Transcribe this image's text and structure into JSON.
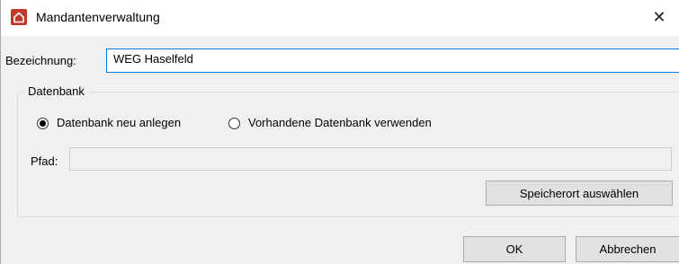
{
  "window": {
    "title": "Mandantenverwaltung",
    "icon": "home-icon",
    "close_glyph": "✕"
  },
  "bezeichnung": {
    "label": "Bezeichnung:",
    "value": "WEG Haselfeld"
  },
  "datenbank": {
    "group_label": "Datenbank",
    "options": [
      {
        "label": "Datenbank neu anlegen",
        "selected": true
      },
      {
        "label": "Vorhandene Datenbank verwenden",
        "selected": false
      }
    ],
    "pfad_label": "Pfad:",
    "pfad_value": "",
    "browse_button": "Speicherort auswählen"
  },
  "buttons": {
    "ok": "OK",
    "cancel": "Abbrechen"
  },
  "colors": {
    "accent_border": "#0078d7",
    "icon_red": "#c0392b"
  }
}
